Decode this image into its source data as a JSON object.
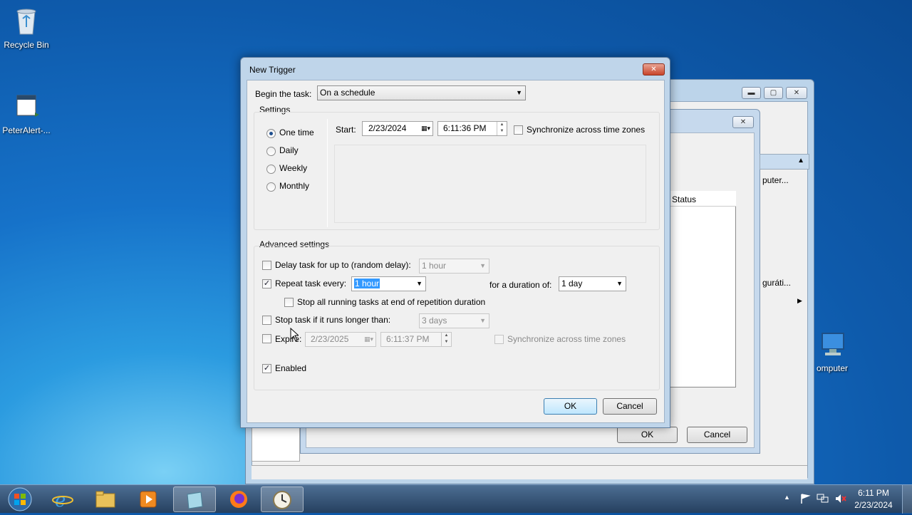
{
  "desktop": {
    "icons": [
      {
        "label": "Recycle Bin"
      },
      {
        "label": "PeterAlert-..."
      },
      {
        "label": "omputer"
      }
    ]
  },
  "background_window": {
    "partial_texts": [
      "puter...",
      "Status",
      "guráti..."
    ],
    "ok_label": "OK",
    "cancel_label": "Cancel"
  },
  "dialog": {
    "title": "New Trigger",
    "close_glyph": "✕",
    "begin_label": "Begin the task:",
    "begin_value": "On a schedule",
    "settings_label": "Settings",
    "schedule_options": [
      {
        "label": "One time",
        "selected": true
      },
      {
        "label": "Daily",
        "selected": false
      },
      {
        "label": "Weekly",
        "selected": false
      },
      {
        "label": "Monthly",
        "selected": false
      }
    ],
    "start_label": "Start:",
    "start_date": "2/23/2024",
    "start_time": "6:11:36 PM",
    "sync_label": "Synchronize across time zones",
    "advanced_label": "Advanced settings",
    "delay_label": "Delay task for up to (random delay):",
    "delay_value": "1 hour",
    "repeat_label": "Repeat task every:",
    "repeat_value": "1 hour",
    "duration_label": "for a duration of:",
    "duration_value": "1 day",
    "stop_running_label": "Stop all running tasks at end of repetition duration",
    "stop_longer_label": "Stop task if it runs longer than:",
    "stop_longer_value": "3 days",
    "expire_label": "Expire:",
    "expire_date": "2/23/2025",
    "expire_time": "6:11:37 PM",
    "expire_sync_label": "Synchronize across time zones",
    "enabled_label": "Enabled",
    "ok_label": "OK",
    "cancel_label": "Cancel",
    "check_glyph": "✓"
  },
  "taskbar": {
    "time": "6:11 PM",
    "date": "2/23/2024"
  }
}
